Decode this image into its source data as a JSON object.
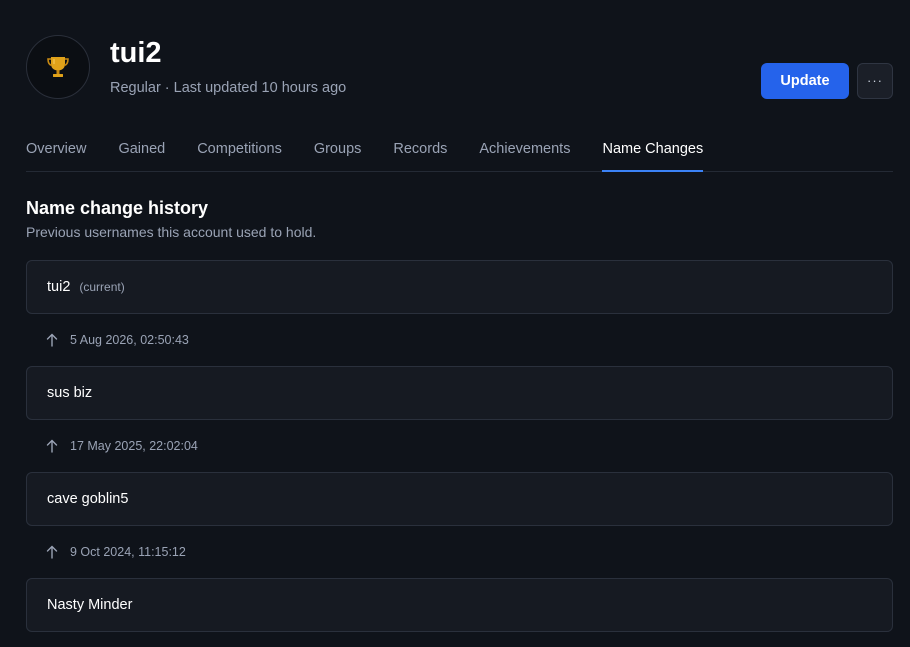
{
  "player": {
    "name": "tui2",
    "meta": "Regular · Last updated 10 hours ago",
    "avatar_icon": "trophy-icon"
  },
  "actions": {
    "update_label": "Update",
    "more_label": "···"
  },
  "tabs": [
    {
      "label": "Overview",
      "active": false
    },
    {
      "label": "Gained",
      "active": false
    },
    {
      "label": "Competitions",
      "active": false
    },
    {
      "label": "Groups",
      "active": false
    },
    {
      "label": "Records",
      "active": false
    },
    {
      "label": "Achievements",
      "active": false
    },
    {
      "label": "Name Changes",
      "active": true
    }
  ],
  "section": {
    "title": "Name change history",
    "subtitle": "Previous usernames this account used to hold."
  },
  "history": {
    "current_tag": "(current)",
    "names": [
      "tui2",
      "sus biz",
      "cave goblin5",
      "Nasty Minder"
    ],
    "change_dates": [
      "5 Aug 2026, 02:50:43",
      "17 May 2025, 22:02:04",
      "9 Oct 2024, 11:15:12"
    ]
  },
  "colors": {
    "background": "#0f131a",
    "accent": "#2563eb",
    "tab_underline": "#3b82f6",
    "card_bg": "#161a22",
    "muted_text": "#9aa3b5"
  }
}
